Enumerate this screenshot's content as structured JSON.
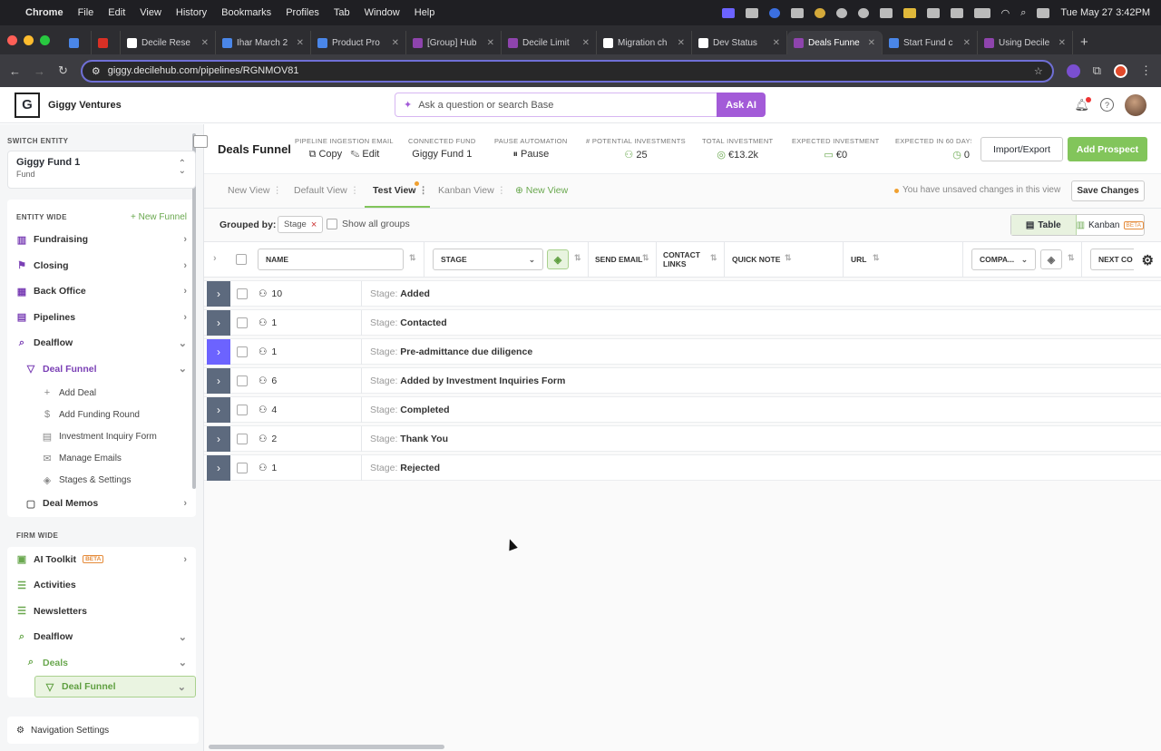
{
  "menubar": {
    "app": "Chrome",
    "items": [
      "File",
      "Edit",
      "View",
      "History",
      "Bookmarks",
      "Profiles",
      "Tab",
      "Window",
      "Help"
    ],
    "clock": "Tue May 27  3:42PM"
  },
  "tabs": [
    {
      "label": "",
      "color": "#4a86e8"
    },
    {
      "label": "",
      "color": "#d93025"
    },
    {
      "label": "Decile Rese",
      "color": "#ffffff"
    },
    {
      "label": "Ihar March 2",
      "color": "#4a86e8"
    },
    {
      "label": "Product Pro",
      "color": "#4a86e8"
    },
    {
      "label": "[Group] Hub",
      "color": "#8e44ad"
    },
    {
      "label": "Decile Limit",
      "color": "#8e44ad"
    },
    {
      "label": "Migration ch",
      "color": "#ffffff"
    },
    {
      "label": "Dev Status",
      "color": "#ffffff"
    },
    {
      "label": "Deals Funne",
      "color": "#8e44ad",
      "active": true
    },
    {
      "label": "Start Fund c",
      "color": "#4a86e8"
    },
    {
      "label": "Using Decile",
      "color": "#8e44ad"
    }
  ],
  "browser": {
    "url": "giggy.decilehub.com/pipelines/RGNMOV81"
  },
  "header": {
    "company": "Giggy Ventures",
    "search_placeholder": "Ask a question or search Base",
    "ask_ai": "Ask AI"
  },
  "sidebar": {
    "switch_label": "SWITCH ENTITY",
    "entity_name": "Giggy Fund 1",
    "entity_type": "Fund",
    "entity_wide": "ENTITY WIDE",
    "new_funnel": "+ New Funnel",
    "items": [
      {
        "label": "Fundraising"
      },
      {
        "label": "Closing"
      },
      {
        "label": "Back Office"
      },
      {
        "label": "Pipelines"
      },
      {
        "label": "Dealflow"
      }
    ],
    "deal_funnel": "Deal Funnel",
    "funnel_items": [
      {
        "label": "Add Deal",
        "icon": "+"
      },
      {
        "label": "Add Funding Round",
        "icon": "$"
      },
      {
        "label": "Investment Inquiry Form",
        "icon": "▤"
      },
      {
        "label": "Manage Emails",
        "icon": "✉"
      },
      {
        "label": "Stages & Settings",
        "icon": "◈"
      }
    ],
    "deal_memos": "Deal Memos",
    "firm_wide": "FIRM WIDE",
    "firm_items": [
      {
        "label": "AI Toolkit",
        "beta": "BETA"
      },
      {
        "label": "Activities"
      },
      {
        "label": "Newsletters"
      },
      {
        "label": "Dealflow"
      }
    ],
    "deals": "Deals",
    "deal_funnel2": "Deal Funnel",
    "nav_settings": "Navigation Settings"
  },
  "topbar": {
    "title": "Deals Funnel",
    "ingest_label": "PIPELINE INGESTION EMAIL",
    "copy": "Copy",
    "edit": "Edit",
    "connected_label": "CONNECTED FUND",
    "connected_value": "Giggy Fund 1",
    "pause_label": "PAUSE AUTOMATION",
    "pause_value": "Pause",
    "potential_label": "# POTENTIAL INVESTMENTS",
    "potential_value": "25",
    "total_label": "TOTAL INVESTMENT",
    "total_value": "€13.2k",
    "expected_label": "EXPECTED INVESTMENT",
    "expected_value": "€0",
    "expected60_label": "EXPECTED IN 60 DAYS",
    "expected60_value": "0",
    "import_export": "Import/Export",
    "add_prospect": "Add Prospect"
  },
  "views": {
    "tabs": [
      "New View",
      "Default View",
      "Test View",
      "Kanban View"
    ],
    "new_view": "New View",
    "unsaved": "You have unsaved changes in this view",
    "save": "Save Changes"
  },
  "grouping": {
    "label": "Grouped by:",
    "chip": "Stage",
    "show_all": "Show all groups",
    "table": "Table",
    "kanban": "Kanban",
    "beta": "BETA"
  },
  "columns": {
    "name": "NAME",
    "stage": "STAGE",
    "send_email": "SEND EMAIL",
    "contact_links": "CONTACT LINKS",
    "quick_note": "QUICK NOTE",
    "url": "URL",
    "company": "COMPA...",
    "next": "NEXT CO"
  },
  "groups": [
    {
      "count": "10",
      "prefix": "Stage:",
      "stage": "Added"
    },
    {
      "count": "1",
      "prefix": "Stage:",
      "stage": "Contacted"
    },
    {
      "count": "1",
      "prefix": "Stage:",
      "stage": "Pre-admittance due diligence"
    },
    {
      "count": "6",
      "prefix": "Stage:",
      "stage": "Added by Investment Inquiries Form"
    },
    {
      "count": "4",
      "prefix": "Stage:",
      "stage": "Completed"
    },
    {
      "count": "2",
      "prefix": "Stage:",
      "stage": "Thank You"
    },
    {
      "count": "1",
      "prefix": "Stage:",
      "stage": "Rejected"
    }
  ]
}
